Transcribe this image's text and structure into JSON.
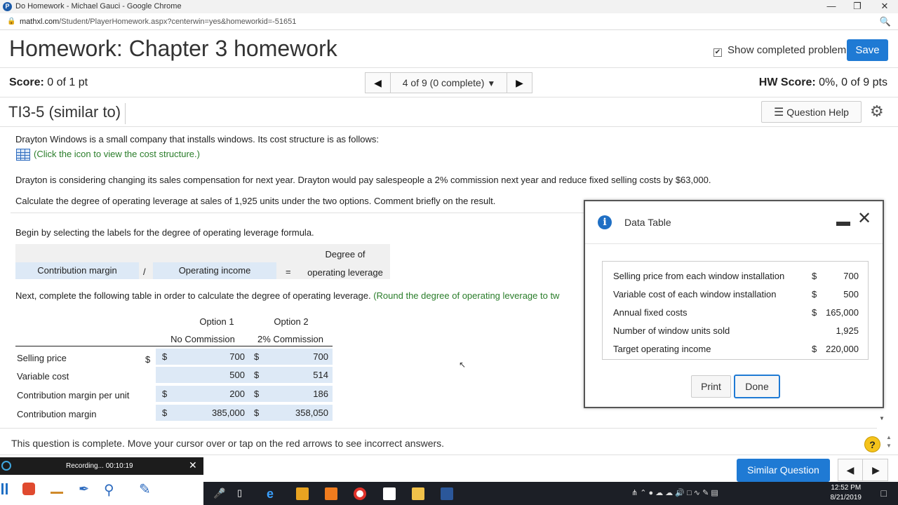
{
  "browser": {
    "window_title": "Do Homework - Michael Gauci - Google Chrome",
    "url_host": "mathxl.com",
    "url_path": "/Student/PlayerHomework.aspx?centerwin=yes&homeworkid=-51651"
  },
  "header": {
    "title": "Homework: Chapter 3 homework",
    "show_completed_label": "Show completed problem",
    "show_completed_checked": true,
    "save_label": "Save"
  },
  "scorebar": {
    "score_label": "Score:",
    "score_value": "0 of 1 pt",
    "pager_text": "4 of 9 (0 complete)",
    "hw_score_label": "HW Score:",
    "hw_score_value": "0%, 0 of 9 pts"
  },
  "question": {
    "id": "TI3-5 (similar to)",
    "help_label": "Question Help",
    "intro": "Drayton Windows is a small company that installs windows. Its cost structure is as follows:",
    "table_link": "(Click the icon to view the cost structure.)",
    "p2": "Drayton is considering changing its sales compensation for next year. Drayton would pay salespeople a 2% commission next year and reduce fixed selling costs by $63,000.",
    "p3": "Calculate the degree of operating leverage at sales of 1,925 units under the two options. Comment briefly on the result.",
    "p4": "Begin by selecting the labels for the degree of operating leverage formula.",
    "formula": {
      "numerator": "Contribution margin",
      "divide": "/",
      "denominator": "Operating income",
      "equals": "=",
      "result_line1": "Degree of",
      "result_line2": "operating leverage"
    },
    "p5": "Next, complete the following table in order to calculate the degree of operating leverage.",
    "p5_hint": "(Round the degree of operating leverage to tw",
    "table": {
      "col1_title": "Option 1",
      "col1_sub": "No Commission",
      "col2_title": "Option 2",
      "col2_sub": "2% Commission",
      "rows": [
        {
          "label": "Selling price",
          "c1": "$",
          "v1": "700",
          "c2": "$",
          "v2": "700"
        },
        {
          "label": "Variable cost",
          "c1": "",
          "v1": "500",
          "c2": "$",
          "v2": "514"
        },
        {
          "label": "Contribution margin per unit",
          "c1": "$",
          "v1": "200",
          "c2": "$",
          "v2": "186"
        },
        {
          "label": "Contribution margin",
          "c1": "$",
          "v1": "385,000",
          "c2": "$",
          "v2": "358,050"
        }
      ]
    },
    "complete_msg": "This question is complete. Move your cursor over or tap on the red arrows to see incorrect answers.",
    "similar_label": "Similar Question"
  },
  "modal": {
    "title": "Data Table",
    "rows": [
      {
        "label": "Selling price from each window installation",
        "cur": "$",
        "value": "700"
      },
      {
        "label": "Variable cost of each window installation",
        "cur": "$",
        "value": "500"
      },
      {
        "label": "Annual fixed costs",
        "cur": "$",
        "value": "165,000"
      },
      {
        "label": "Number of window units sold",
        "cur": "",
        "value": "1,925"
      },
      {
        "label": "Target operating income",
        "cur": "$",
        "value": "220,000"
      }
    ],
    "print_label": "Print",
    "done_label": "Done"
  },
  "recording": {
    "label": "Recording... 00:10:19"
  },
  "taskbar": {
    "time": "12:52 PM",
    "date": "8/21/2019"
  },
  "colors": {
    "accent": "#1f7ad4",
    "answer_cell": "#dde9f6",
    "link_green": "#2a7d2a"
  }
}
